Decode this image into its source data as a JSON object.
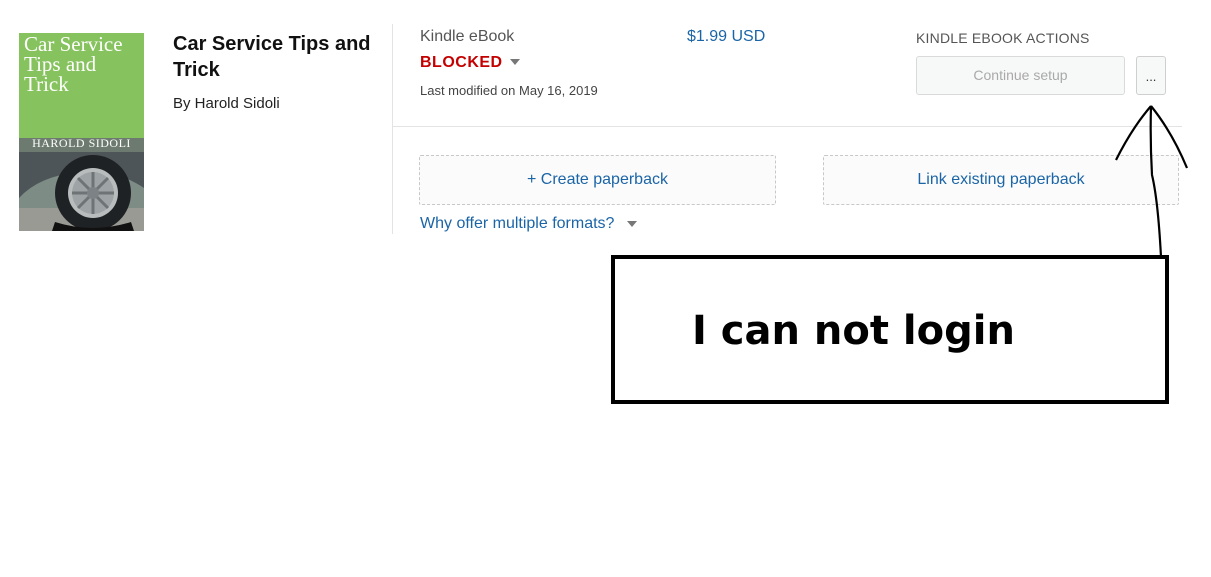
{
  "book": {
    "cover": {
      "title_lines": [
        "Car Service",
        "Tips and",
        "Trick"
      ],
      "author": "HAROLD SIDOLI",
      "background": "#86c25e"
    },
    "title": "Car Service Tips and Trick",
    "author": "By Harold Sidoli"
  },
  "ebook": {
    "format": "Kindle eBook",
    "status": "BLOCKED",
    "status_color": "#c40000",
    "last_modified": "Last modified on May 16, 2019",
    "price": "$1.99 USD"
  },
  "actions": {
    "title": "KINDLE EBOOK ACTIONS",
    "continue_label": "Continue setup",
    "more_label": "..."
  },
  "paperback": {
    "create_label": "+ Create paperback",
    "link_label": "Link existing paperback",
    "why_label": "Why offer multiple formats?"
  },
  "annotation": {
    "text": "I can not login"
  },
  "colors": {
    "link": "#1b65a7",
    "divider": "#e3e3e3"
  }
}
